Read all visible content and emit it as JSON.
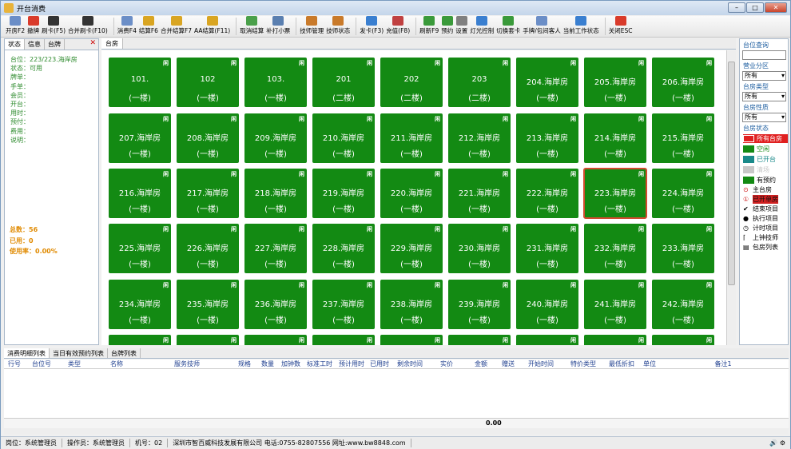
{
  "window": {
    "title": "开台消费"
  },
  "toolbar": [
    {
      "label": "开房F2",
      "icon": "doc-icon",
      "color": "#6b8ec7"
    },
    {
      "label": "撤牌",
      "icon": "cross-icon",
      "color": "#d93b2b"
    },
    {
      "label": "刷卡(F5)",
      "icon": "barcode-icon",
      "color": "#333333"
    },
    {
      "label": "合并刷卡(F10)",
      "icon": "barcode-icon",
      "color": "#333333"
    },
    {
      "label": "消费F4",
      "icon": "doc-icon",
      "color": "#6b8ec7"
    },
    {
      "label": "结算F6",
      "icon": "money-icon",
      "color": "#d9a522"
    },
    {
      "label": "合并结算F7",
      "icon": "money-icon",
      "color": "#d9a522"
    },
    {
      "label": "AA结算(F11)",
      "icon": "money-icon",
      "color": "#d9a522"
    },
    {
      "label": "取消结算",
      "icon": "undo-icon",
      "color": "#4aa04a"
    },
    {
      "label": "补打小票",
      "icon": "printer-icon",
      "color": "#5a7fb0"
    },
    {
      "label": "技师管理",
      "icon": "people-icon",
      "color": "#c97a2a"
    },
    {
      "label": "技师状态",
      "icon": "people-icon",
      "color": "#c97a2a"
    },
    {
      "label": "发卡(F3)",
      "icon": "person-icon",
      "color": "#3a7fd0"
    },
    {
      "label": "充值(F8)",
      "icon": "card-icon",
      "color": "#c04040"
    },
    {
      "label": "刷新F9",
      "icon": "refresh-icon",
      "color": "#3a9a3a"
    },
    {
      "label": "预约",
      "icon": "pen-icon",
      "color": "#3a9a3a"
    },
    {
      "label": "设置",
      "icon": "gear-icon",
      "color": "#808080"
    },
    {
      "label": "灯光控制",
      "icon": "people-icon",
      "color": "#3a7fd0"
    },
    {
      "label": "切换套卡",
      "icon": "switch-icon",
      "color": "#3a9a3a"
    },
    {
      "label": "手牌/包间客人",
      "icon": "doc-icon",
      "color": "#6b8ec7"
    },
    {
      "label": "当前工作状态",
      "icon": "people-icon",
      "color": "#3a7fd0"
    },
    {
      "label": "关闭ESC",
      "icon": "power-icon",
      "color": "#d93b2b"
    }
  ],
  "left": {
    "tabs": [
      "状态",
      "信息",
      "台牌"
    ],
    "fields": [
      "台位：223/223.海岸房",
      "状态：可用",
      "牌单：",
      "手单：",
      "会员：",
      "开台：",
      "用时：",
      "预付：",
      "费用：",
      "说明："
    ],
    "total": "总数：56",
    "used": "已用：0",
    "rate": "使用率：0.00%"
  },
  "center": {
    "tab": "台房"
  },
  "rooms": [
    {
      "name": "101.",
      "floor": "(一楼)",
      "badge": "闲"
    },
    {
      "name": "102",
      "floor": "(一楼)",
      "badge": "闲"
    },
    {
      "name": "103.",
      "floor": "(一楼)",
      "badge": "闲"
    },
    {
      "name": "201",
      "floor": "(二楼)",
      "badge": "闲"
    },
    {
      "name": "202",
      "floor": "(二楼)",
      "badge": "闲"
    },
    {
      "name": "203",
      "floor": "(二楼)",
      "badge": "闲"
    },
    {
      "name": "204.海岸房",
      "floor": "(一楼)",
      "badge": "闲"
    },
    {
      "name": "205.海岸房",
      "floor": "(一楼)",
      "badge": "闲"
    },
    {
      "name": "206.海岸房",
      "floor": "(一楼)",
      "badge": "闲"
    },
    {
      "name": "207.海岸房",
      "floor": "(一楼)",
      "badge": "闲"
    },
    {
      "name": "208.海岸房",
      "floor": "(一楼)",
      "badge": "闲"
    },
    {
      "name": "209.海岸房",
      "floor": "(一楼)",
      "badge": "闲"
    },
    {
      "name": "210.海岸房",
      "floor": "(一楼)",
      "badge": "闲"
    },
    {
      "name": "211.海岸房",
      "floor": "(一楼)",
      "badge": "闲"
    },
    {
      "name": "212.海岸房",
      "floor": "(一楼)",
      "badge": "闲"
    },
    {
      "name": "213.海岸房",
      "floor": "(一楼)",
      "badge": "闲"
    },
    {
      "name": "214.海岸房",
      "floor": "(一楼)",
      "badge": "闲"
    },
    {
      "name": "215.海岸房",
      "floor": "(一楼)",
      "badge": "闲"
    },
    {
      "name": "216.海岸房",
      "floor": "(一楼)",
      "badge": "闲"
    },
    {
      "name": "217.海岸房",
      "floor": "(一楼)",
      "badge": "闲"
    },
    {
      "name": "218.海岸房",
      "floor": "(一楼)",
      "badge": "闲"
    },
    {
      "name": "219.海岸房",
      "floor": "(一楼)",
      "badge": "闲"
    },
    {
      "name": "220.海岸房",
      "floor": "(一楼)",
      "badge": "闲"
    },
    {
      "name": "221.海岸房",
      "floor": "(一楼)",
      "badge": "闲"
    },
    {
      "name": "222.海岸房",
      "floor": "(一楼)",
      "badge": "闲"
    },
    {
      "name": "223.海岸房",
      "floor": "(一楼)",
      "badge": "闲",
      "selected": true
    },
    {
      "name": "224.海岸房",
      "floor": "(一楼)",
      "badge": "闲"
    },
    {
      "name": "225.海岸房",
      "floor": "(一楼)",
      "badge": "闲"
    },
    {
      "name": "226.海岸房",
      "floor": "(一楼)",
      "badge": "闲"
    },
    {
      "name": "227.海岸房",
      "floor": "(一楼)",
      "badge": "闲"
    },
    {
      "name": "228.海岸房",
      "floor": "(一楼)",
      "badge": "闲"
    },
    {
      "name": "229.海岸房",
      "floor": "(一楼)",
      "badge": "闲"
    },
    {
      "name": "230.海岸房",
      "floor": "(一楼)",
      "badge": "闲"
    },
    {
      "name": "231.海岸房",
      "floor": "(一楼)",
      "badge": "闲"
    },
    {
      "name": "232.海岸房",
      "floor": "(一楼)",
      "badge": "闲"
    },
    {
      "name": "233.海岸房",
      "floor": "(一楼)",
      "badge": "闲"
    },
    {
      "name": "234.海岸房",
      "floor": "(一楼)",
      "badge": "闲"
    },
    {
      "name": "235.海岸房",
      "floor": "(一楼)",
      "badge": "闲"
    },
    {
      "name": "236.海岸房",
      "floor": "(一楼)",
      "badge": "闲"
    },
    {
      "name": "237.海岸房",
      "floor": "(一楼)",
      "badge": "闲"
    },
    {
      "name": "238.海岸房",
      "floor": "(一楼)",
      "badge": "闲"
    },
    {
      "name": "239.海岸房",
      "floor": "(一楼)",
      "badge": "闲"
    },
    {
      "name": "240.海岸房",
      "floor": "(一楼)",
      "badge": "闲"
    },
    {
      "name": "241.海岸房",
      "floor": "(一楼)",
      "badge": "闲"
    },
    {
      "name": "242.海岸房",
      "floor": "(一楼)",
      "badge": "闲"
    },
    {
      "name": "",
      "floor": "",
      "badge": "闲"
    },
    {
      "name": "",
      "floor": "",
      "badge": "闲"
    },
    {
      "name": "",
      "floor": "",
      "badge": "闲"
    },
    {
      "name": "",
      "floor": "",
      "badge": "闲"
    },
    {
      "name": "",
      "floor": "",
      "badge": "闲"
    },
    {
      "name": "",
      "floor": "",
      "badge": "闲"
    },
    {
      "name": "",
      "floor": "",
      "badge": "闲"
    },
    {
      "name": "",
      "floor": "",
      "badge": "闲"
    },
    {
      "name": "",
      "floor": "",
      "badge": "闲"
    }
  ],
  "right": {
    "query": "台位查询",
    "zone": "营业分区",
    "zone_value": "所有",
    "type": "台房类型",
    "type_value": "所有",
    "nature": "台房性质",
    "nature_value": "所有",
    "status": "台房状态",
    "legend": [
      {
        "label": "所有台房",
        "color": "#e02020",
        "text": "#ffffff"
      },
      {
        "label": "空闲",
        "color": "#138a13",
        "text": "#138a13"
      },
      {
        "label": "已开台",
        "color": "#1a8a8a",
        "text": "#1a8a8a"
      },
      {
        "label": "清场",
        "color": "#c8c8c8",
        "text": "#c8c8c8"
      },
      {
        "label": "有预约",
        "color": "#138a13",
        "text": "#000000"
      }
    ],
    "icons": [
      {
        "label": "主台房",
        "icon": "target-icon",
        "sym": "⊙"
      },
      {
        "label": "已开单房",
        "icon": "alert-icon",
        "sym": "①"
      },
      {
        "label": "结束项目",
        "icon": "check-icon",
        "sym": "✔"
      },
      {
        "label": "执行项目",
        "icon": "run-icon",
        "sym": "●"
      },
      {
        "label": "计时项目",
        "icon": "clock-icon",
        "sym": "◷"
      },
      {
        "label": "上钟技师",
        "icon": "bracket-icon",
        "sym": "⌈"
      },
      {
        "label": "包房列表",
        "icon": "list-icon",
        "sym": "▤"
      }
    ]
  },
  "bottom": {
    "tabs": [
      "消费明细列表",
      "当日有效预约列表",
      "台牌列表"
    ],
    "columns": [
      "行号",
      "台位号",
      "类型",
      "名称",
      "服务技师",
      "规格",
      "数量",
      "加钟数",
      "标准工时",
      "预计用时",
      "已用时",
      "剩余时间",
      "实价",
      "金额",
      "赠送",
      "开始时间",
      "特价类型",
      "最低折扣",
      "单位",
      "备注1"
    ],
    "total": "0.00"
  },
  "status": {
    "post": "岗位：系统管理员",
    "operator": "操作员：系统管理员",
    "machine": "机号：02",
    "company": "深圳市智百威科技发展有限公司 电话:0755-82807556 网址:www.bw8848.com"
  }
}
